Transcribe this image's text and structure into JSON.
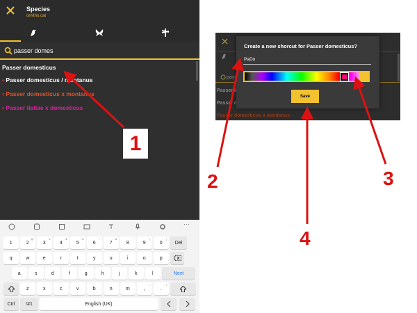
{
  "header": {
    "title": "Species",
    "subtitle": "ornitho.cat"
  },
  "search": {
    "value": "passer domes"
  },
  "results": [
    {
      "label": "Passer domesticus",
      "color": "#ffffff",
      "bullet": false
    },
    {
      "label": "Passer domesticus / montanus",
      "color": "#ffffff",
      "bullet": true
    },
    {
      "label": "Passer domesticus x montanus",
      "color": "#e0552b",
      "bullet": true
    },
    {
      "label": "Passer italiae x domesticus",
      "color": "#d6249f",
      "bullet": true
    }
  ],
  "keyboard": {
    "row1": [
      {
        "k": "1"
      },
      {
        "k": "2",
        "s": "@"
      },
      {
        "k": "3",
        "s": "#"
      },
      {
        "k": "4",
        "s": "$"
      },
      {
        "k": "5",
        "s": "%"
      },
      {
        "k": "6",
        "s": "^"
      },
      {
        "k": "7",
        "s": "&"
      },
      {
        "k": "8",
        "s": "*"
      },
      {
        "k": "9",
        "s": "("
      },
      {
        "k": "0",
        "s": ")"
      },
      {
        "k": "Del"
      }
    ],
    "row2": [
      "q",
      "w",
      "e",
      "r",
      "t",
      "y",
      "u",
      "i",
      "o",
      "p"
    ],
    "row3": [
      "a",
      "s",
      "d",
      "f",
      "g",
      "h",
      "j",
      "k",
      "l"
    ],
    "row3_action": "Next",
    "row4": [
      "z",
      "x",
      "c",
      "v",
      "b",
      "n",
      "m"
    ],
    "row4_punct": [
      {
        "k": ",",
        "s": "!"
      },
      {
        "k": ".",
        "s": "?"
      }
    ],
    "row5": {
      "ctrl": "Ctrl",
      "sym": "!#1",
      "space": "English (UK)"
    }
  },
  "dialog": {
    "title": "Create a new shorcut for Passer domesticus?",
    "input_value": "PaDo",
    "save_label": "Save"
  },
  "annotations": {
    "n1": "1",
    "n2": "2",
    "n3": "3",
    "n4": "4"
  },
  "colors": {
    "accent": "#f2c230",
    "arrow": "#dd1111",
    "bg_dark": "#2f2f2f"
  }
}
